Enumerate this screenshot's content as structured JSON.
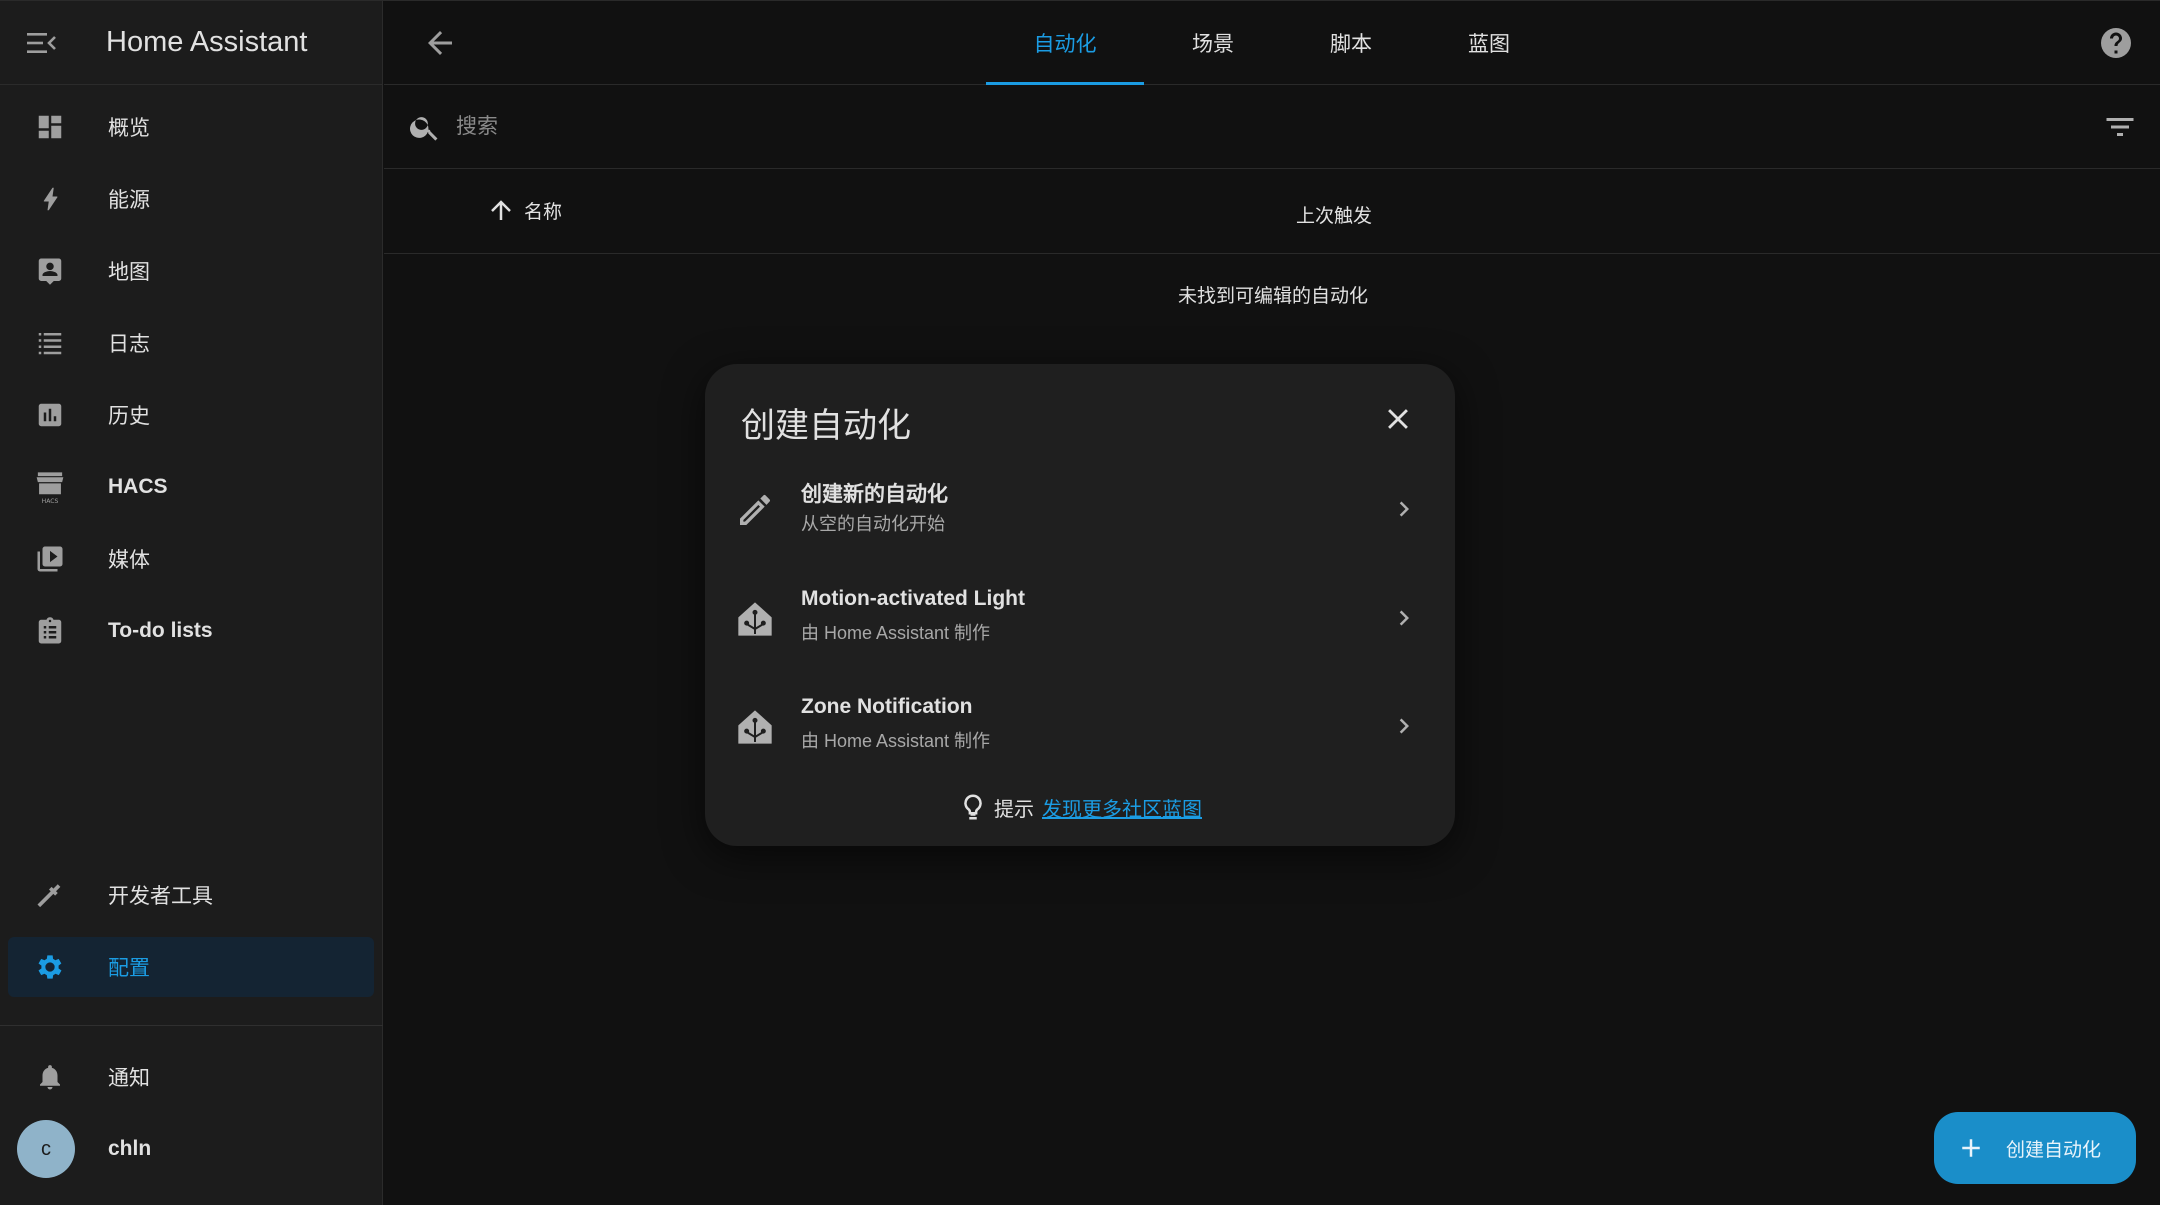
{
  "app": {
    "title": "Home Assistant",
    "accent": "#1b9ce3"
  },
  "sidebar": {
    "items": [
      {
        "label": "概览",
        "icon": "dashboard-icon"
      },
      {
        "label": "能源",
        "icon": "lightning-icon"
      },
      {
        "label": "地图",
        "icon": "map-icon"
      },
      {
        "label": "日志",
        "icon": "list-icon"
      },
      {
        "label": "历史",
        "icon": "chart-icon"
      },
      {
        "label": "HACS",
        "icon": "hacs-icon"
      },
      {
        "label": "媒体",
        "icon": "media-icon"
      },
      {
        "label": "To-do lists",
        "icon": "clipboard-icon"
      }
    ],
    "developer_tools": "开发者工具",
    "settings": "配置",
    "notifications": "通知",
    "user": {
      "initial": "c",
      "name": "chln"
    }
  },
  "topbar": {
    "tabs": [
      "自动化",
      "场景",
      "脚本",
      "蓝图"
    ],
    "active_tab": "自动化"
  },
  "search": {
    "placeholder": "搜索"
  },
  "table": {
    "columns": {
      "name": "名称",
      "last_triggered": "上次触发"
    },
    "empty_message": "未找到可编辑的自动化"
  },
  "dialog": {
    "title": "创建自动化",
    "items": [
      {
        "primary": "创建新的自动化",
        "secondary": "从空的自动化开始",
        "icon": "pencil-icon"
      },
      {
        "primary": "Motion-activated Light",
        "secondary": "由 Home Assistant 制作",
        "icon": "home-assistant-icon"
      },
      {
        "primary": "Zone Notification",
        "secondary": "由 Home Assistant 制作",
        "icon": "home-assistant-icon"
      }
    ],
    "tip_label": "提示",
    "tip_link": "发现更多社区蓝图"
  },
  "fab": {
    "label": "创建自动化"
  }
}
